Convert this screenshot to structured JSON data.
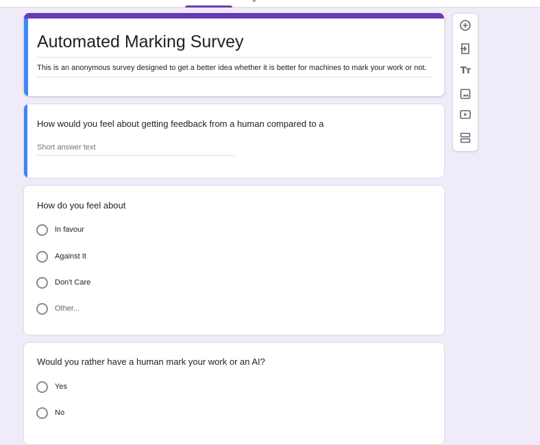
{
  "form": {
    "title": "Automated Marking Survey",
    "description": "This is an anonymous survey designed to get a better idea whether it is better for machines to mark your work or not."
  },
  "questions": [
    {
      "title": "How would you feel about getting feedback from a human compared to a",
      "type": "short-answer",
      "placeholder": "Short answer text"
    },
    {
      "title": "How do you feel about",
      "type": "multiple-choice",
      "options": [
        "In favour",
        "Against It",
        "Don't Care",
        "Other..."
      ]
    },
    {
      "title": "Would you rather have a human mark your work or an AI?",
      "type": "multiple-choice",
      "options": [
        "Yes",
        "No"
      ]
    }
  ],
  "toolbar": {
    "icons": [
      "add-question-icon",
      "import-questions-icon",
      "add-title-icon",
      "add-image-icon",
      "add-video-icon",
      "add-section-icon"
    ]
  },
  "colors": {
    "theme_purple": "#673ab7",
    "background": "#f0ebf8",
    "active_accent": "#4285f4",
    "icon_gray": "#5f6368"
  }
}
